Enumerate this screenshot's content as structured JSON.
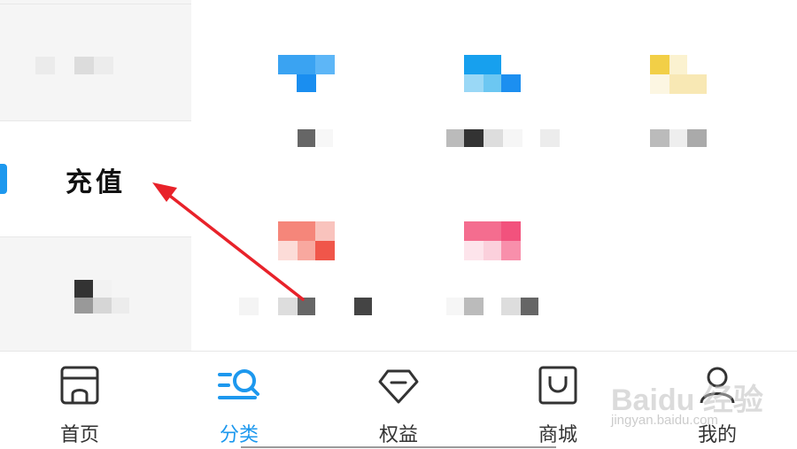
{
  "sidebar": {
    "items": [
      {
        "label": "",
        "state": "blurred"
      },
      {
        "label": "充值",
        "state": "active"
      },
      {
        "label": "",
        "state": "blurred"
      }
    ],
    "active_color": "#1d98ee"
  },
  "category_grid": {
    "items": [
      {
        "icon": "blurred-blue-icon",
        "label": ""
      },
      {
        "icon": "blurred-cyan-icon",
        "label": ""
      },
      {
        "icon": "blurred-yellow-icon",
        "label": ""
      },
      {
        "icon": "blurred-red-icon",
        "label": ""
      },
      {
        "icon": "blurred-pink-icon",
        "label": ""
      }
    ]
  },
  "annotation": {
    "color": "#e8222a",
    "icon": "red-arrow"
  },
  "tabbar": {
    "tabs": [
      {
        "label": "首页",
        "icon": "home-icon",
        "active": false
      },
      {
        "label": "分类",
        "icon": "category-search-icon",
        "active": true
      },
      {
        "label": "权益",
        "icon": "diamond-icon",
        "active": false
      },
      {
        "label": "商城",
        "icon": "shopping-bag-icon",
        "active": false
      },
      {
        "label": "我的",
        "icon": "person-icon",
        "active": false
      }
    ]
  },
  "watermark": {
    "main": "Baidu 经验",
    "sub": "jingyan.baidu.com"
  },
  "colors": {
    "accent": "#1d98ee",
    "sidebar_bg": "#f5f5f5",
    "arrow": "#e8222a"
  }
}
